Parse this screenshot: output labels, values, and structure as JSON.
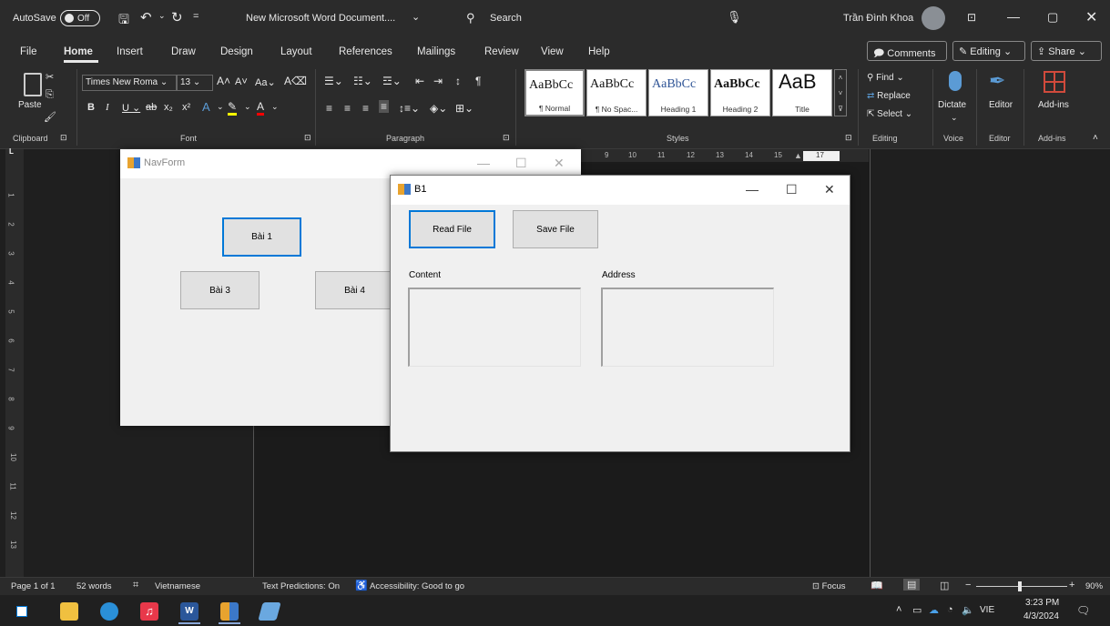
{
  "titlebar": {
    "autosave_label": "AutoSave",
    "autosave_state": "Off",
    "doc_title": "New Microsoft Word Document....",
    "search_label": "Search",
    "user_name": "Trần Đình Khoa"
  },
  "menu": [
    "File",
    "Home",
    "Insert",
    "Draw",
    "Design",
    "Layout",
    "References",
    "Mailings",
    "Review",
    "View",
    "Help"
  ],
  "menu_active": "Home",
  "menu_right": {
    "comments": "Comments",
    "editing": "Editing",
    "share": "Share"
  },
  "ribbon": {
    "paste": "Paste",
    "font_name": "Times New Roma",
    "font_size": "13",
    "styles": [
      {
        "preview": "AaBbCc",
        "label": "¶ Normal"
      },
      {
        "preview": "AaBbCc",
        "label": "¶ No Spac..."
      },
      {
        "preview": "AaBbCc",
        "label": "Heading 1"
      },
      {
        "preview": "AaBbCc",
        "label": "Heading 2"
      },
      {
        "preview": "AaB",
        "label": "Title"
      }
    ],
    "find": "Find",
    "replace": "Replace",
    "select": "Select",
    "dictate": "Dictate",
    "editor": "Editor",
    "addins": "Add-ins",
    "groups": [
      "Clipboard",
      "Font",
      "Paragraph",
      "Styles",
      "Editing",
      "Voice",
      "Editor",
      "Add-ins"
    ]
  },
  "ruler": {
    "h_numbers": [
      "9",
      "10",
      "11",
      "12",
      "13",
      "14",
      "15",
      "17"
    ],
    "v_numbers": [
      "1",
      "2",
      "3",
      "4",
      "5",
      "6",
      "7",
      "8",
      "9",
      "10",
      "11",
      "12",
      "13"
    ]
  },
  "navform": {
    "title": "NavForm",
    "buttons": {
      "bai1": "Bài 1",
      "bai3": "Bài 3",
      "bai4": "Bài 4"
    }
  },
  "b1": {
    "title": "B1",
    "read_file": "Read File",
    "save_file": "Save File",
    "content_label": "Content",
    "address_label": "Address"
  },
  "status": {
    "page": "Page 1 of 1",
    "words": "52 words",
    "language": "Vietnamese",
    "text_predictions": "Text Predictions: On",
    "accessibility": "Accessibility: Good to go",
    "focus": "Focus",
    "zoom": "90%"
  },
  "taskbar": {
    "language": "VIE",
    "time": "3:23 PM",
    "date": "4/3/2024"
  },
  "colors": {
    "accent": "#0078d7",
    "word_blue": "#2b579a"
  }
}
